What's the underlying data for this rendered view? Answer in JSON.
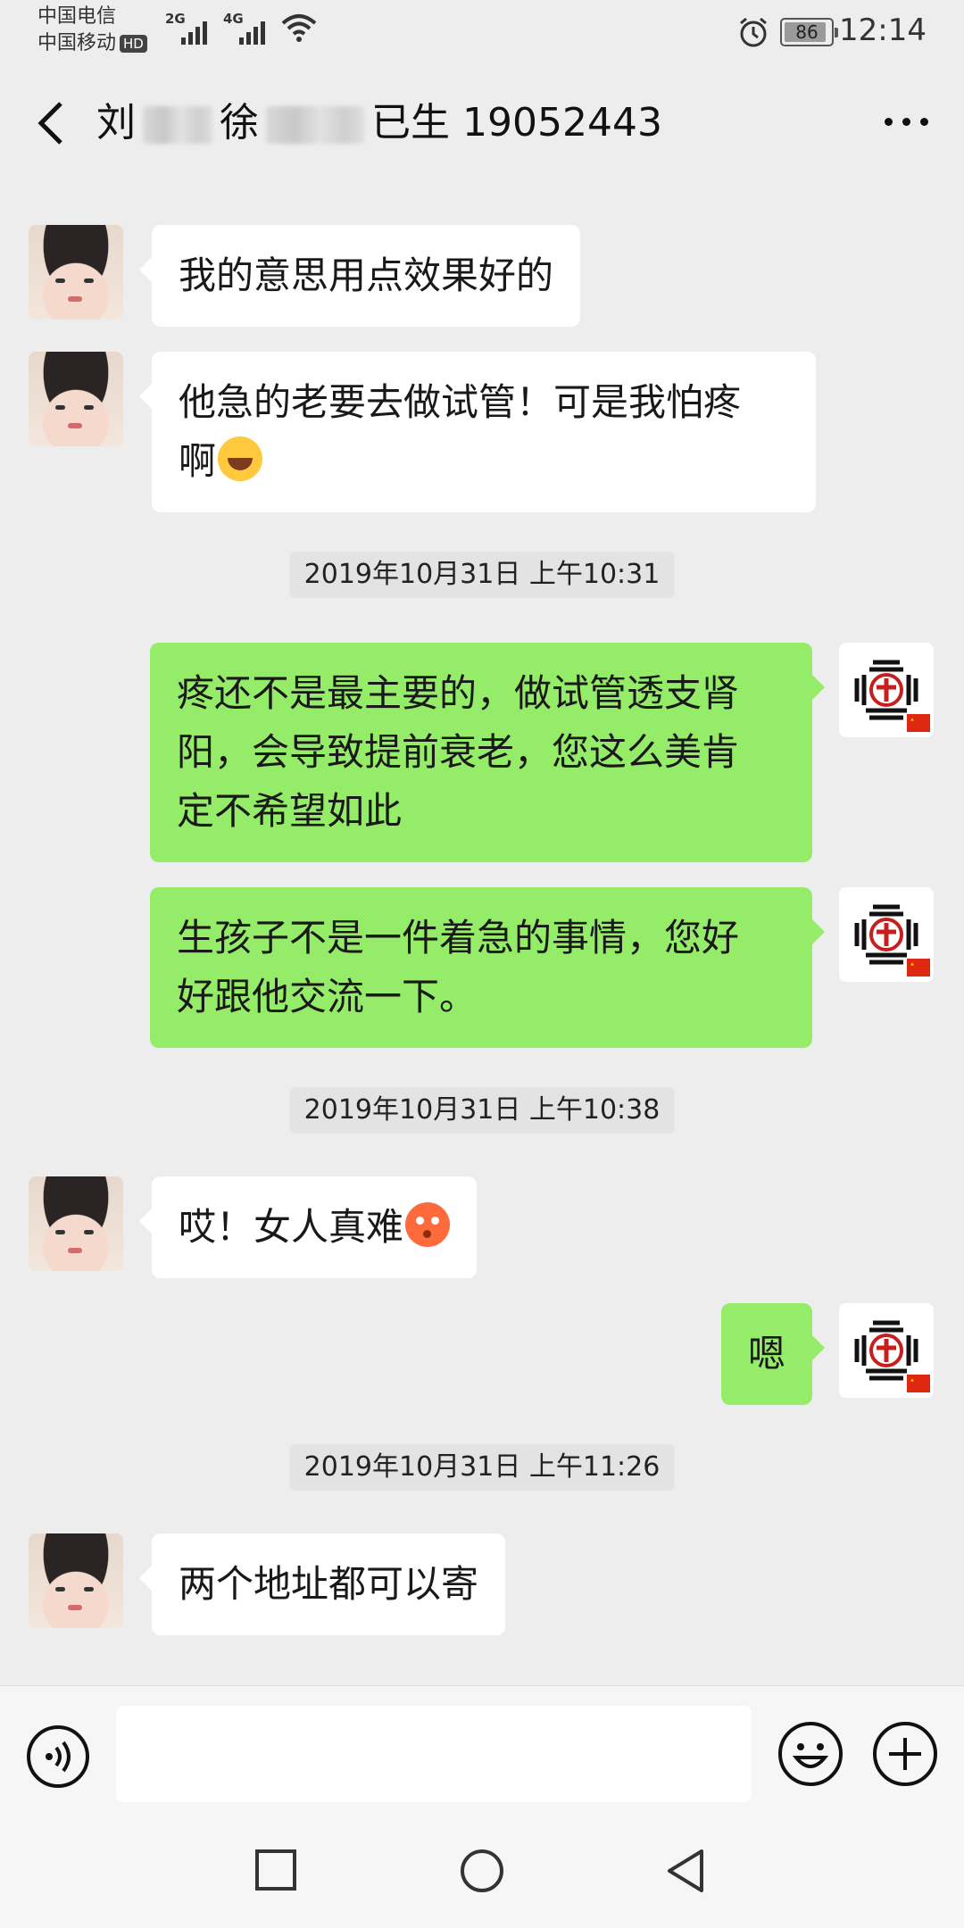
{
  "status_bar": {
    "carrier1": "中国电信",
    "carrier2": "中国移动",
    "hd_badge": "HD",
    "signal1_label": "2G",
    "signal2_label": "4G",
    "battery": "86",
    "time": "12:14"
  },
  "header": {
    "name_part1": "刘",
    "name_part2": "徐",
    "name_part3": "已生 19052443"
  },
  "messages": [
    {
      "kind": "in",
      "text": "我的意思用点效果好的"
    },
    {
      "kind": "in",
      "text_line1": "他急的老要去做试管！可是我怕疼",
      "text_line2": "啊",
      "emoji": "laughing-emoji"
    },
    {
      "kind": "time",
      "text": "2019年10月31日 上午10:31"
    },
    {
      "kind": "out",
      "text_line1": "疼还不是最主要的，做试管透支肾",
      "text_line2": "阳，会导致提前衰老，您这么美肯",
      "text_line3": "定不希望如此"
    },
    {
      "kind": "out",
      "text_line1": "生孩子不是一件着急的事情，您好",
      "text_line2": "好跟他交流一下。"
    },
    {
      "kind": "time",
      "text": "2019年10月31日 上午10:38"
    },
    {
      "kind": "in",
      "text": "哎！女人真难",
      "emoji": "flushed-emoji"
    },
    {
      "kind": "out",
      "text": "嗯"
    },
    {
      "kind": "time",
      "text": "2019年10月31日 上午11:26"
    },
    {
      "kind": "in",
      "text": "两个地址都可以寄"
    }
  ],
  "input_bar": {
    "voice_icon": "voice-icon",
    "text_value": "",
    "emoji_icon": "emoji-icon",
    "plus_icon": "plus-icon"
  },
  "system_nav": {
    "recent": "square-recent-icon",
    "home": "circle-home-icon",
    "back": "triangle-back-icon"
  },
  "colors": {
    "background": "#ededed",
    "bubble_in": "#ffffff",
    "bubble_out": "#95ec69"
  }
}
